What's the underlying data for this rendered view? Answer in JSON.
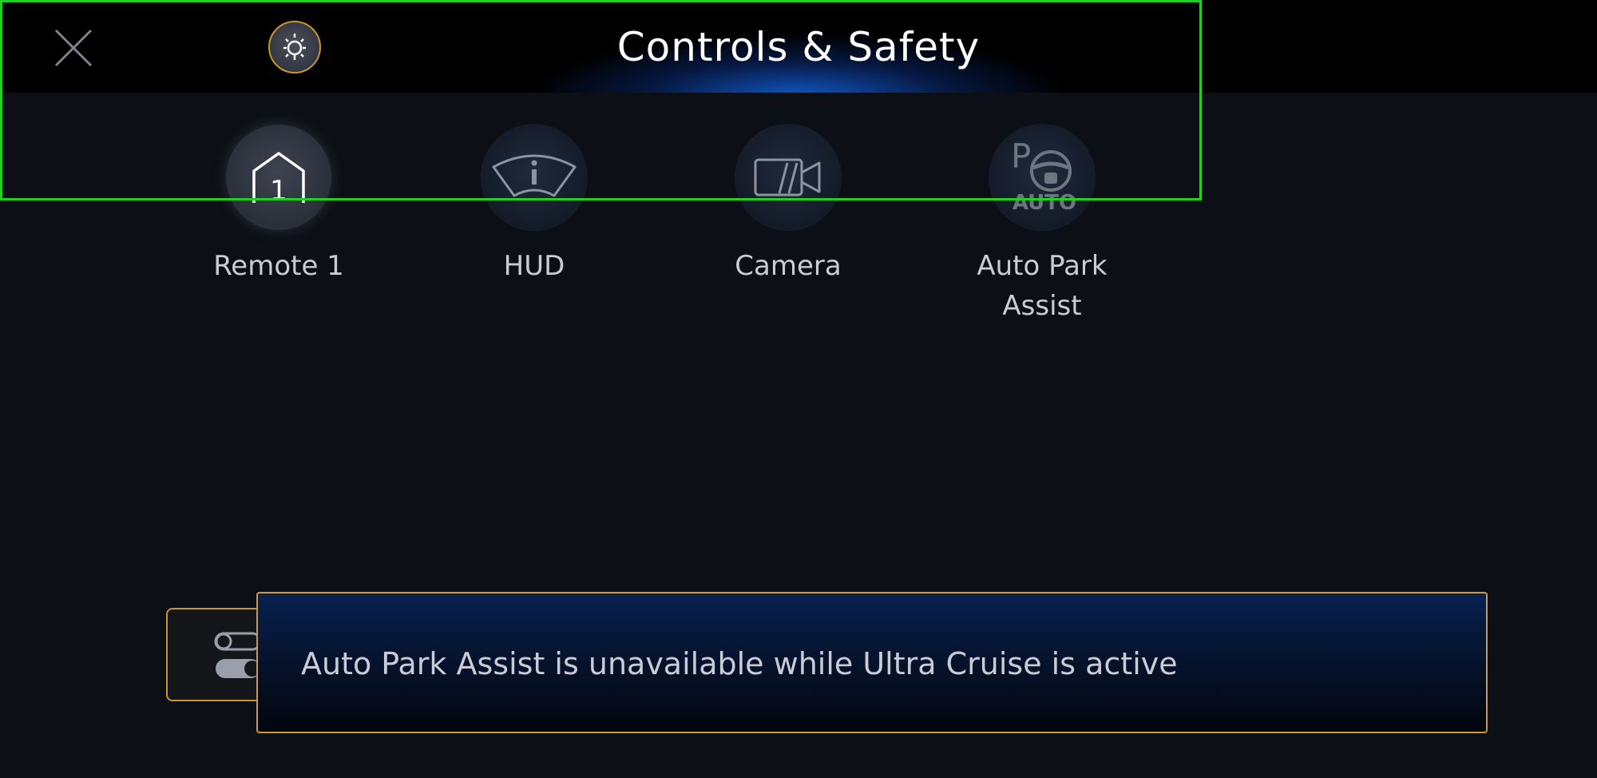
{
  "header": {
    "title": "Controls & Safety",
    "close_icon": "close-icon",
    "light_icon": "bulb-icon"
  },
  "quick_controls": [
    {
      "label": "Remote 1",
      "icon": "garage-remote-icon",
      "badge": "1",
      "active": true
    },
    {
      "label": "HUD",
      "icon": "hud-icon",
      "active": false
    },
    {
      "label": "Camera",
      "icon": "camera-icon",
      "active": false
    },
    {
      "label": "Auto Park\nAssist",
      "icon": "auto-park-assist-icon",
      "icon_text": "AUTO",
      "icon_letter": "P",
      "active": false
    }
  ],
  "toast": {
    "message": "Auto Park Assist is unavailable while Ultra Cruise is active",
    "icon": "toggle-icon"
  },
  "colors": {
    "background": "#0c0f15",
    "header_glow": "#125cd2",
    "accent_amber": "#c8962a",
    "highlight_green": "#1ed21e",
    "label_text": "#c9ccd3"
  }
}
